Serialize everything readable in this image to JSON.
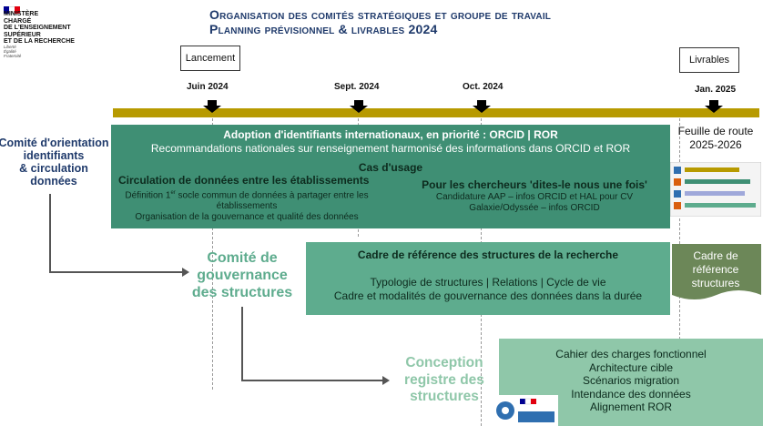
{
  "logo": {
    "lines": [
      "MINISTÈRE",
      "CHARGÉ",
      "DE L'ENSEIGNEMENT",
      "SUPÉRIEUR",
      "ET DE LA RECHERCHE"
    ],
    "motto": [
      "Liberté",
      "Égalité",
      "Fraternité"
    ]
  },
  "title": {
    "line1": "Organisation des comités stratégiques et groupe de travail",
    "line2": "Planning prévisionnel & livrables 2024"
  },
  "milestones": {
    "lancement": "Lancement",
    "livrables": "Livrables"
  },
  "dates": [
    "Juin 2024",
    "Sept. 2024",
    "Oct. 2024",
    "Jan. 2025"
  ],
  "committee": {
    "line1": "Comité d'orientation",
    "line2": "identifiants",
    "line3": "& circulation",
    "line4": "données"
  },
  "block1": {
    "heading": "Adoption d'identifiants internationaux, en priorité : ORCID | ROR",
    "subheading": "Recommandations nationales sur renseignement harmonisé des informations dans ORCID et ROR",
    "cases_title": "Cas d'usage",
    "left_title": "Circulation de données entre les établissements",
    "left_line1_a": "Définition 1",
    "left_line1_sup": "er",
    "left_line1_b": " socle commun de données à partager entre les",
    "left_line2": "établissements",
    "left_line3": "Organisation de la gouvernance et qualité des données",
    "right_title": "Pour les chercheurs 'dites-le nous une fois'",
    "right_line1": "Candidature AAP – infos ORCID et HAL pour CV",
    "right_line2": "Galaxie/Odyssée – infos ORCID"
  },
  "roadmap": {
    "line1": "Feuille de route",
    "line2": "2025-2026"
  },
  "governance": {
    "line1": "Comité de",
    "line2": "gouvernance",
    "line3": "des structures"
  },
  "block2": {
    "heading": "Cadre de référence des structures de la recherche",
    "line1": "Typologie de structures | Relations | Cycle de vie",
    "line2": "Cadre et modalités de gouvernance des données dans la durée"
  },
  "deliverable2": {
    "line1": "Cadre de",
    "line2": "référence",
    "line3": "structures"
  },
  "conception": {
    "line1": "Conception",
    "line2": "registre des",
    "line3": "structures"
  },
  "block3": {
    "items": [
      "Cahier des charges fonctionnel",
      "Architecture cible",
      "Scénarios migration",
      "Intendance des données",
      "Alignement ROR"
    ]
  },
  "colors": {
    "title": "#1f3a6b",
    "timeline": "#b79a00",
    "green_dark": "#3f8f74",
    "green_mid": "#5eac8e",
    "green_light": "#8fc7a9",
    "olive": "#6c8758"
  }
}
